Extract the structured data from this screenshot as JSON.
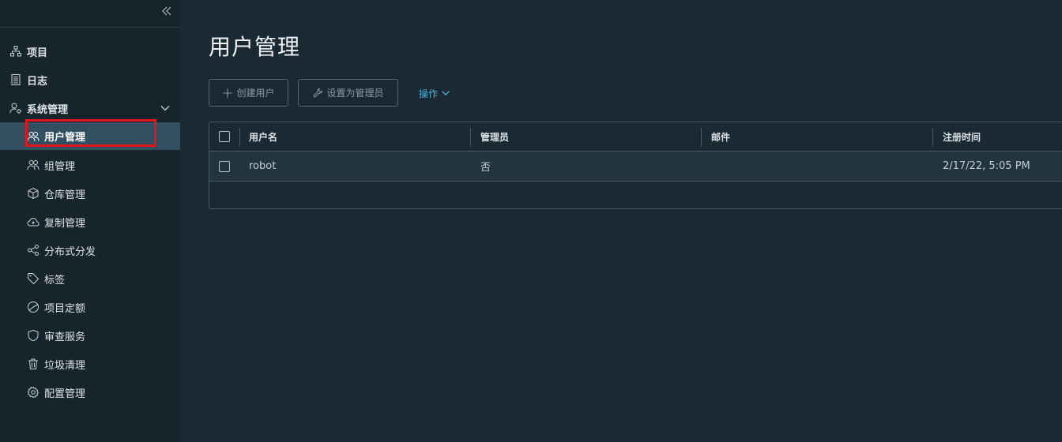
{
  "sidebar": {
    "collapse_icon": "double-chevron-left-icon",
    "items": [
      {
        "label": "项目",
        "icon": "sitemap-icon"
      },
      {
        "label": "日志",
        "icon": "log-icon"
      },
      {
        "label": "系统管理",
        "icon": "admin-gear-icon"
      }
    ],
    "sub_items": [
      {
        "label": "用户管理",
        "icon": "users-icon",
        "active": true
      },
      {
        "label": "组管理",
        "icon": "group-icon"
      },
      {
        "label": "仓库管理",
        "icon": "cube-icon"
      },
      {
        "label": "复制管理",
        "icon": "cloud-sync-icon"
      },
      {
        "label": "分布式分发",
        "icon": "share-icon"
      },
      {
        "label": "标签",
        "icon": "tag-icon"
      },
      {
        "label": "项目定额",
        "icon": "pie-icon"
      },
      {
        "label": "审查服务",
        "icon": "shield-icon"
      },
      {
        "label": "垃圾清理",
        "icon": "trash-icon"
      },
      {
        "label": "配置管理",
        "icon": "gear-icon"
      }
    ]
  },
  "main": {
    "title": "用户管理",
    "toolbar": {
      "create_user": "创建用户",
      "set_admin": "设置为管理员",
      "actions": "操作"
    },
    "table": {
      "columns": [
        "用户名",
        "管理员",
        "邮件",
        "注册时间"
      ],
      "rows": [
        {
          "username": "robot",
          "admin": "否",
          "email": "",
          "registered": "2/17/22, 5:05 PM"
        }
      ]
    }
  },
  "colors": {
    "sidebar_bg": "#17242b",
    "main_bg": "#1b2a32",
    "active_bg": "#324f61",
    "accent": "#49afd9",
    "highlight": "#e0161a"
  }
}
